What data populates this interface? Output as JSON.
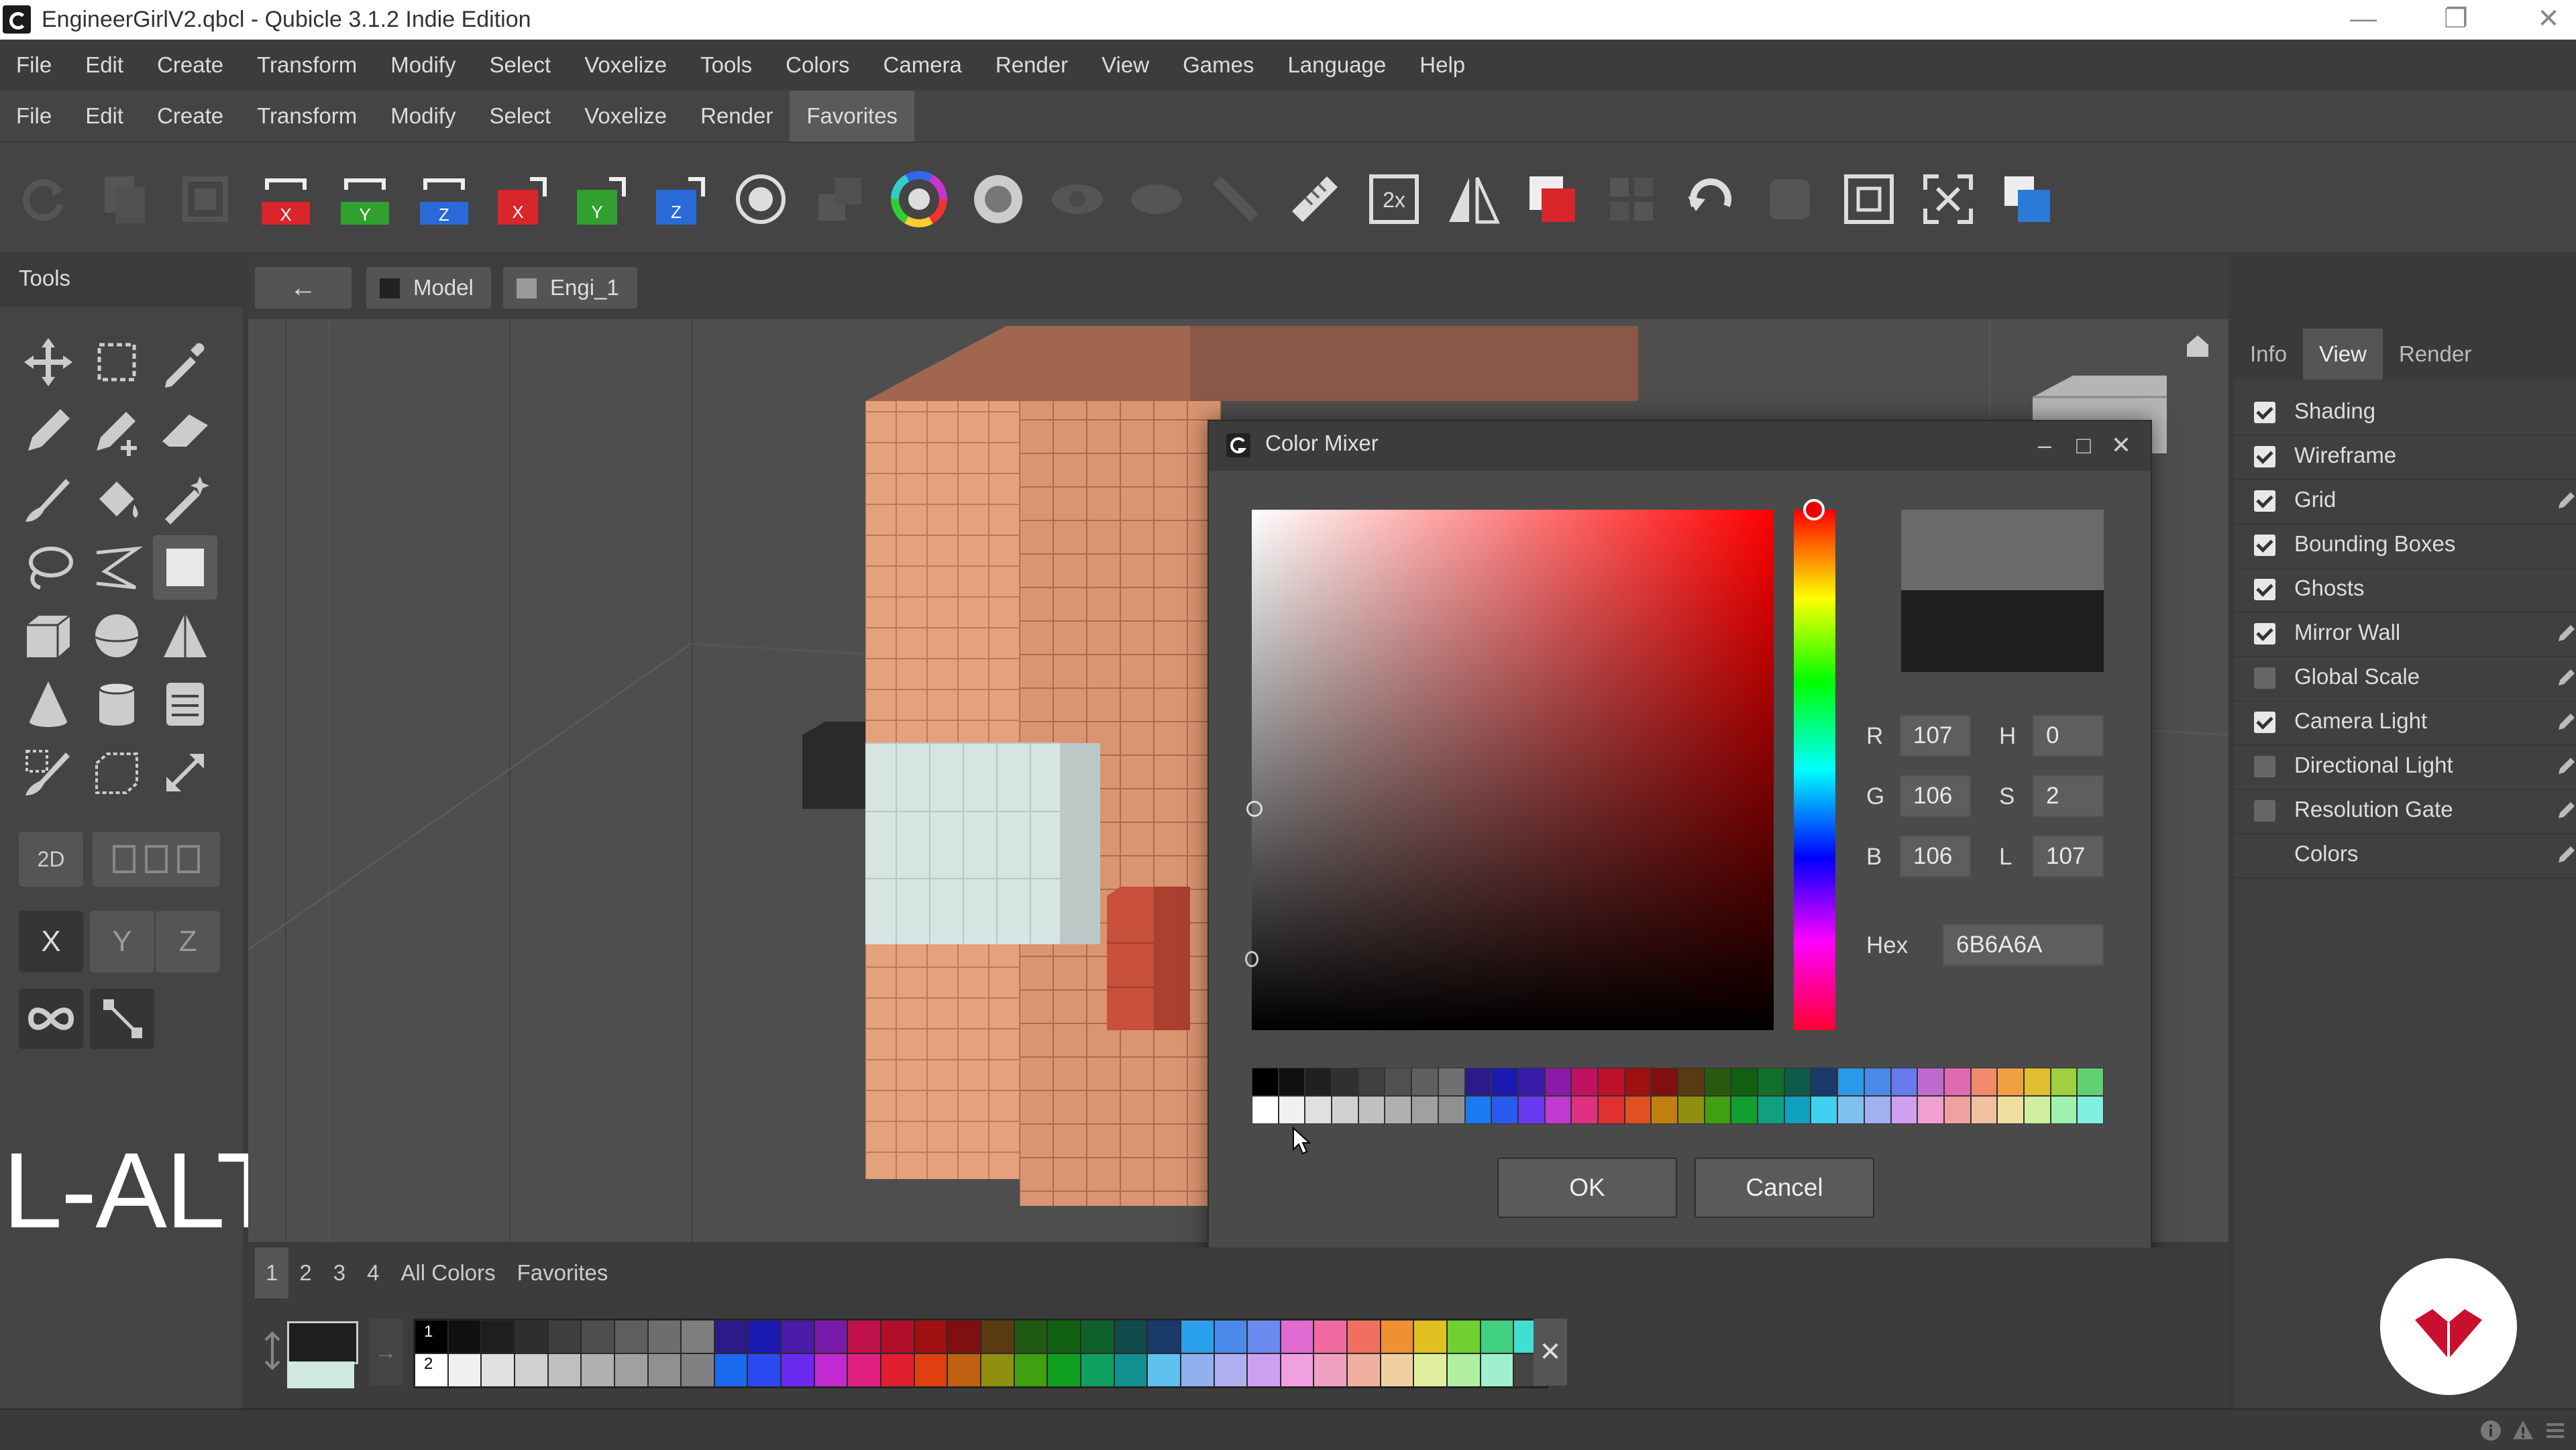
{
  "window": {
    "title": "EngineerGirlV2.qbcl - Qubicle 3.1.2 Indie Edition",
    "minimize": "—",
    "restore": "❐",
    "close": "✕"
  },
  "menu_main": [
    "File",
    "Edit",
    "Create",
    "Transform",
    "Modify",
    "Select",
    "Voxelize",
    "Tools",
    "Colors",
    "Camera",
    "Render",
    "View",
    "Games",
    "Language",
    "Help"
  ],
  "menu_fav": [
    "File",
    "Edit",
    "Create",
    "Transform",
    "Modify",
    "Select",
    "Voxelize",
    "Render",
    "Favorites"
  ],
  "menu_fav_active": "Favorites",
  "toolbar_icons": [
    "redo-icon",
    "copy-icon",
    "clone-icon",
    "mirror-x-red-icon",
    "mirror-y-green-icon",
    "mirror-z-blue-icon",
    "rotate-x-red-icon",
    "rotate-y-green-icon",
    "rotate-z-blue-icon",
    "center-pivot-icon",
    "hollow-icon",
    "color-wheel-icon",
    "gradient-sphere-icon",
    "eye-icon",
    "eye-closed-icon",
    "pen-line-icon",
    "ruler-icon",
    "scale-2x-icon",
    "mirror-symmetry-icon",
    "boolean-subtract-icon",
    "grid-pattern-icon",
    "refresh-icon",
    "shadow-icon",
    "fit-selection-icon",
    "fit-all-icon",
    "duplicate-blue-icon"
  ],
  "toolbar_letters": {
    "x": "X",
    "y": "Y",
    "z": "Z",
    "scale": "2x"
  },
  "tools": {
    "title": "Tools",
    "mode_2d": "2D",
    "axis_x": "X",
    "axis_y": "Y",
    "axis_z": "Z",
    "icons": [
      "move-icon",
      "select-box-icon",
      "eyedropper-icon",
      "pencil-icon",
      "pencil-plus-icon",
      "eraser-icon",
      "brush-icon",
      "fill-bucket-icon",
      "magic-wand-icon",
      "lasso-icon",
      "polyline-icon",
      "rectangle-icon",
      "cube-icon",
      "sphere-icon",
      "pyramid-icon",
      "cone-icon",
      "cylinder-icon",
      "stack-icon",
      "select-brush-icon",
      "select-cube-icon",
      "resize-icon"
    ]
  },
  "key_overlay": "L-ALT",
  "viewport": {
    "back_label": "←",
    "tab_model": "Model",
    "tab_matrix": "Engi_1"
  },
  "right_panel": {
    "tabs": [
      "Info",
      "View",
      "Render"
    ],
    "active_tab": "View",
    "options": [
      {
        "label": "Shading",
        "checked": true,
        "editable": false
      },
      {
        "label": "Wireframe",
        "checked": true,
        "editable": false
      },
      {
        "label": "Grid",
        "checked": true,
        "editable": true
      },
      {
        "label": "Bounding Boxes",
        "checked": true,
        "editable": false
      },
      {
        "label": "Ghosts",
        "checked": true,
        "editable": false
      },
      {
        "label": "Mirror Wall",
        "checked": true,
        "editable": true
      },
      {
        "label": "Global Scale",
        "checked": false,
        "editable": true
      },
      {
        "label": "Camera Light",
        "checked": true,
        "editable": true
      },
      {
        "label": "Directional Light",
        "checked": false,
        "editable": true
      },
      {
        "label": "Resolution Gate",
        "checked": false,
        "editable": true
      },
      {
        "label": "Colors",
        "checked": null,
        "editable": true
      }
    ]
  },
  "color_mixer": {
    "title": "Color Mixer",
    "r_label": "R",
    "r_value": "107",
    "g_label": "G",
    "g_value": "106",
    "b_label": "B",
    "b_value": "106",
    "h_label": "H",
    "h_value": "0",
    "s_label": "S",
    "s_value": "2",
    "l_label": "L",
    "l_value": "107",
    "hex_label": "Hex",
    "hex_value": "6B6A6A",
    "new_color": "#6B6A6A",
    "old_color": "#1e1e1e",
    "ok_label": "OK",
    "cancel_label": "Cancel",
    "palette_row1": [
      "#000000",
      "#101010",
      "#202020",
      "#303030",
      "#404040",
      "#505050",
      "#606060",
      "#707070",
      "#2a1a8a",
      "#1a1ab0",
      "#3a1aa8",
      "#8a1aa8",
      "#c01060",
      "#c0102a",
      "#a01010",
      "#801010",
      "#5a3a10",
      "#2a5a10",
      "#106010",
      "#10702a",
      "#105a4a",
      "#1a3a6a",
      "#2a9aea",
      "#4a8aea",
      "#6a7af0",
      "#c06ad0",
      "#e06ab0",
      "#f08a6a",
      "#f0a040",
      "#e0c030",
      "#a0d040",
      "#60d070"
    ],
    "palette_row2": [
      "#ffffff",
      "#f0f0f0",
      "#e0e0e0",
      "#d0d0d0",
      "#c0c0c0",
      "#b0b0b0",
      "#a0a0a0",
      "#909090",
      "#1a7af0",
      "#2a5af0",
      "#6a3af0",
      "#c03ad0",
      "#e03080",
      "#e03030",
      "#e05020",
      "#c08010",
      "#909010",
      "#40a010",
      "#10a030",
      "#10a080",
      "#10a0c0",
      "#40d0f0",
      "#80c0f0",
      "#a0b0f0",
      "#d0a0f0",
      "#f0a0d0",
      "#f0a0a0",
      "#f0c0a0",
      "#f0e0a0",
      "#d0f0a0",
      "#a0f0b0",
      "#80f0e0"
    ]
  },
  "palette": {
    "tabs": [
      "1",
      "2",
      "3",
      "4",
      "All Colors",
      "Favorites"
    ],
    "active_tab": "1",
    "row1_label": "1",
    "row2_label": "2",
    "clear_label": "✕",
    "row1": [
      "#000000",
      "#101010",
      "#1e1e1e",
      "#2e2e2e",
      "#3e3e3e",
      "#4e4e4e",
      "#5e5e5e",
      "#6e6e6e",
      "#7e7e7e",
      "#2a1a8a",
      "#1a1ab0",
      "#4a1aa8",
      "#7a1aa8",
      "#c0104a",
      "#b0102a",
      "#a01010",
      "#801010",
      "#5a3a10",
      "#205a10",
      "#106010",
      "#10602a",
      "#104a4a",
      "#1a3a6a",
      "#2aa0ea",
      "#4a8aea",
      "#6a8af0",
      "#e06ad0",
      "#f06aa0",
      "#f07060",
      "#f09030",
      "#e0c020",
      "#70d030",
      "#40d080",
      "#40e0d0"
    ],
    "row2": [
      "#ffffff",
      "#f0f0f0",
      "#e0e0e0",
      "#d0d0d0",
      "#c0c0c0",
      "#b0b0b0",
      "#a0a0a0",
      "#909090",
      "#808080",
      "#1a6af0",
      "#2a4af0",
      "#6a2af0",
      "#c02ad0",
      "#e02080",
      "#e02030",
      "#e04010",
      "#c06010",
      "#909010",
      "#40a010",
      "#10a020",
      "#10a060",
      "#109090",
      "#60c0f0",
      "#90b0f0",
      "#b0b0f0",
      "#d0a0f0",
      "#f0a0e0",
      "#f0a0c0",
      "#f0b0a0",
      "#f0d0a0",
      "#e0f0a0",
      "#b0f0a0",
      "#a0f0d0"
    ]
  }
}
